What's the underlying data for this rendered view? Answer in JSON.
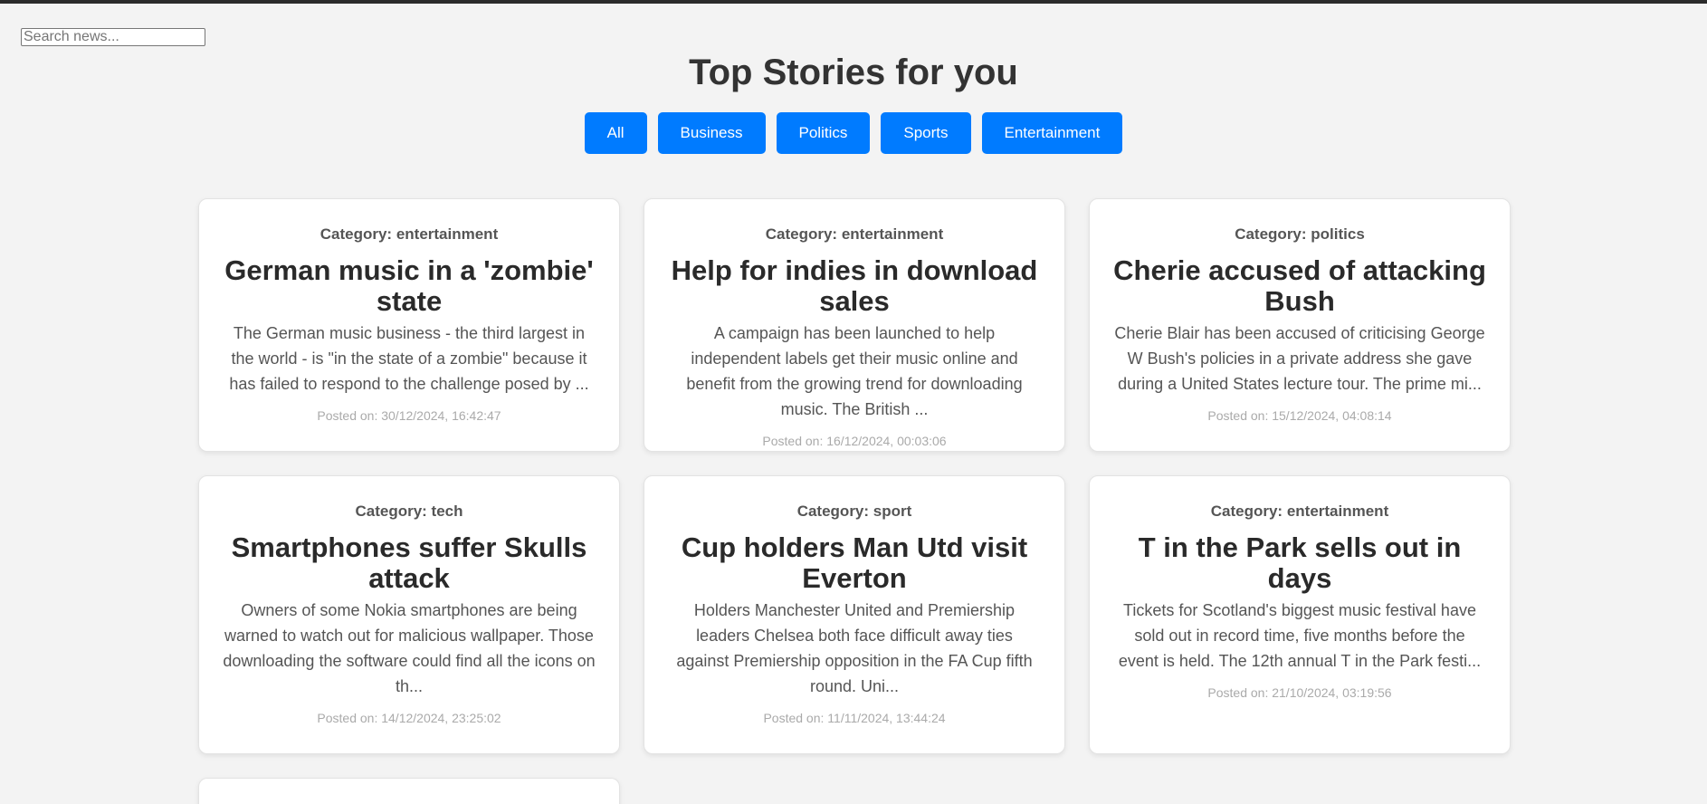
{
  "search": {
    "placeholder": "Search news..."
  },
  "page_title": "Top Stories for you",
  "filters": [
    "All",
    "Business",
    "Politics",
    "Sports",
    "Entertainment"
  ],
  "articles": [
    {
      "category": "Category: entertainment",
      "title": "German music in a 'zombie' state",
      "summary": "The German music business - the third largest in the world - is \"in the state of a zombie\" because it has failed to respond to the challenge posed by ...",
      "date": "Posted on: 30/12/2024, 16:42:47"
    },
    {
      "category": "Category: entertainment",
      "title": "Help for indies in download sales",
      "summary": "A campaign has been launched to help independent labels get their music online and benefit from the growing trend for downloading music. The British ...",
      "date": "Posted on: 16/12/2024, 00:03:06"
    },
    {
      "category": "Category: politics",
      "title": "Cherie accused of attacking Bush",
      "summary": "Cherie Blair has been accused of criticising George W Bush's policies in a private address she gave during a United States lecture tour. The prime mi...",
      "date": "Posted on: 15/12/2024, 04:08:14"
    },
    {
      "category": "Category: tech",
      "title": "Smartphones suffer Skulls attack",
      "summary": "Owners of some Nokia smartphones are being warned to watch out for malicious wallpaper. Those downloading the software could find all the icons on th...",
      "date": "Posted on: 14/12/2024, 23:25:02"
    },
    {
      "category": "Category: sport",
      "title": "Cup holders Man Utd visit Everton",
      "summary": "Holders Manchester United and Premiership leaders Chelsea both face difficult away ties against Premiership opposition in the FA Cup fifth round. Uni...",
      "date": "Posted on: 11/11/2024, 13:44:24"
    },
    {
      "category": "Category: entertainment",
      "title": "T in the Park sells out in days",
      "summary": "Tickets for Scotland's biggest music festival have sold out in record time, five months before the event is held. The 12th annual T in the Park festi...",
      "date": "Posted on: 21/10/2024, 03:19:56"
    }
  ]
}
